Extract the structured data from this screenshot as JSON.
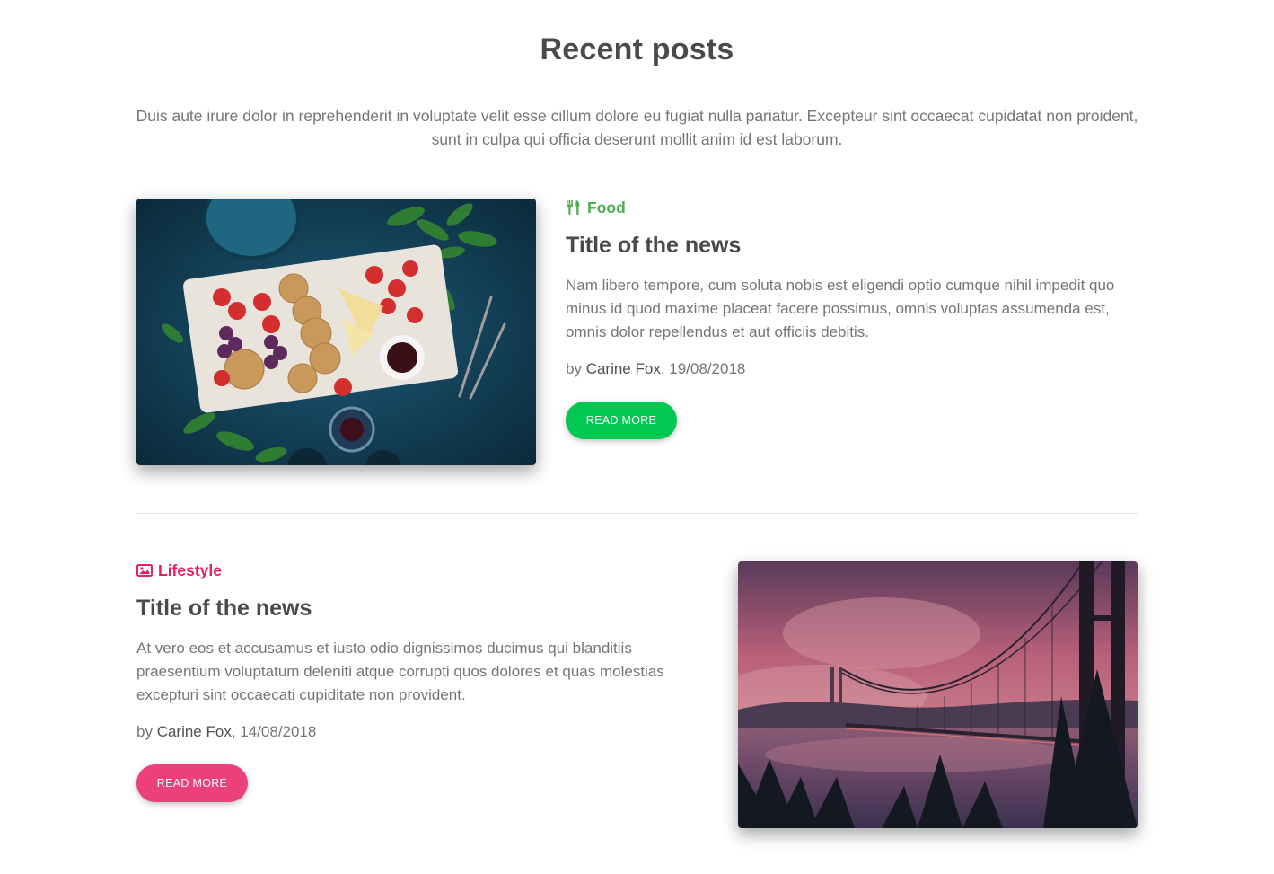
{
  "section": {
    "title": "Recent posts",
    "lead": "Duis aute irure dolor in reprehenderit in voluptate velit esse cillum dolore eu fugiat nulla pariatur. Excepteur sint occaecat cupidatat non proident, sunt in culpa qui officia deserunt mollit anim id est laborum."
  },
  "posts": [
    {
      "category": "Food",
      "category_icon": "utensils-icon",
      "category_color": "#4caf50",
      "title": "Title of the news",
      "excerpt": "Nam libero tempore, cum soluta nobis est eligendi optio cumque nihil impedit quo minus id quod maxime placeat facere possimus, omnis voluptas assumenda est, omnis dolor repellendus et aut officiis debitis.",
      "by": "by ",
      "author": "Carine Fox",
      "date": ", 19/08/2018",
      "button": "READ MORE",
      "button_color": "#00c851"
    },
    {
      "category": "Lifestyle",
      "category_icon": "image-icon",
      "category_color": "#e91e63",
      "title": "Title of the news",
      "excerpt": "At vero eos et accusamus et iusto odio dignissimos ducimus qui blanditiis praesentium voluptatum deleniti atque corrupti quos dolores et quas molestias excepturi sint occaecati cupiditate non provident.",
      "by": "by ",
      "author": "Carine Fox",
      "date": ", 14/08/2018",
      "button": "READ MORE",
      "button_color": "#ec407a"
    }
  ]
}
